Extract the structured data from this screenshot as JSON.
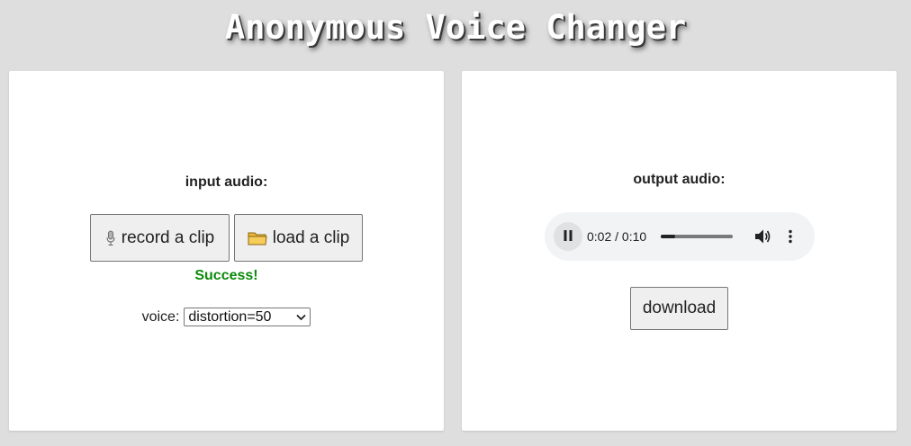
{
  "app": {
    "title": "Anonymous Voice Changer"
  },
  "input_panel": {
    "label": "input audio:",
    "record_label": "record a clip",
    "load_label": "load a clip",
    "status": "Success!",
    "status_color": "#0b8a0b",
    "voice_label": "voice:",
    "voice_selected": "distortion=50"
  },
  "output_panel": {
    "label": "output audio:",
    "player": {
      "time": "0:02 / 0:10",
      "progress": 0.2
    },
    "download_label": "download"
  }
}
